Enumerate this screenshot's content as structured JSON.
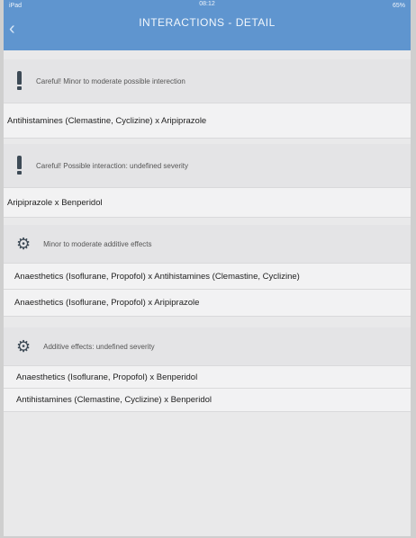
{
  "status_bar": {
    "left": "iPad",
    "time": "08:12",
    "right": "65%"
  },
  "nav": {
    "back_glyph": "‹",
    "title": "INTERACTIONS - DETAIL"
  },
  "sections": [
    {
      "icon": "exclamation-icon",
      "header": "Careful! Minor to moderate possible interection",
      "items": [
        "Antihistamines (Clemastine, Cyclizine) x Aripiprazole"
      ]
    },
    {
      "icon": "exclamation-icon",
      "header": "Careful! Possible interaction: undefined severity",
      "items": [
        "Aripiprazole x Benperidol"
      ]
    },
    {
      "icon": "gear-icon",
      "header": "Minor to moderate additive effects",
      "items": [
        "Anaesthetics (Isoflurane, Propofol) x Antihistamines (Clemastine, Cyclizine)",
        "Anaesthetics (Isoflurane, Propofol) x Aripiprazole"
      ]
    },
    {
      "icon": "gear-icon",
      "header": "Additive effects: undefined severity",
      "items": [
        "Anaesthetics (Isoflurane, Propofol) x Benperidol",
        "Antihistamines (Clemastine, Cyclizine) x Benperidol"
      ]
    }
  ]
}
